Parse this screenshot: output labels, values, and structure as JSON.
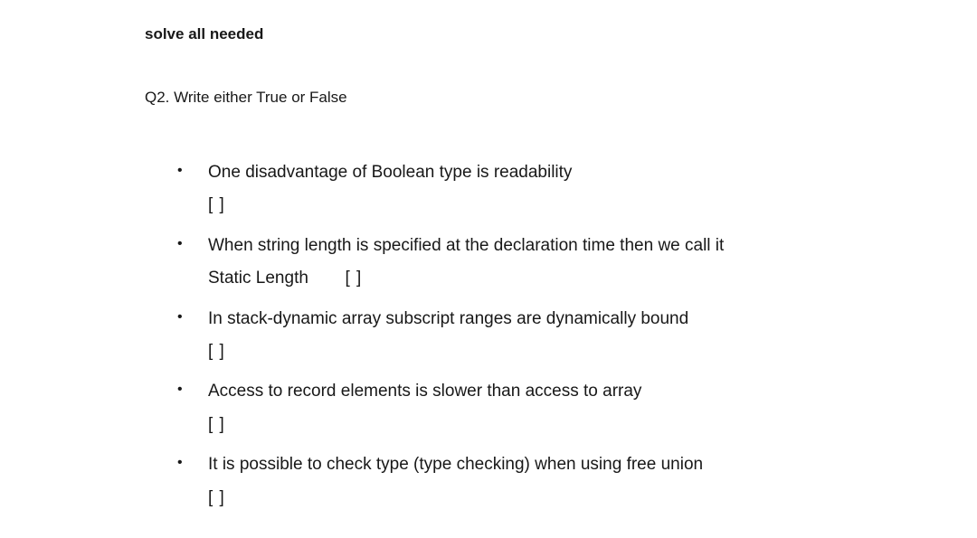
{
  "topInstruction": "solve all needed",
  "questionHeading": "Q2.  Write either True or False",
  "answerBoxText": "[   ]",
  "items": {
    "i1": {
      "textA": "One disadvantage of Boolean type is readability"
    },
    "i2": {
      "textA": "When string length is specified at the declaration time then we call it",
      "textB": "Static Length"
    },
    "i3": {
      "textA": "In stack-dynamic array subscript ranges are dynamically bound"
    },
    "i4": {
      "textA": "Access to record elements is slower than access to array"
    },
    "i5": {
      "textA": "It is possible to check type (type checking) when using free union"
    }
  }
}
